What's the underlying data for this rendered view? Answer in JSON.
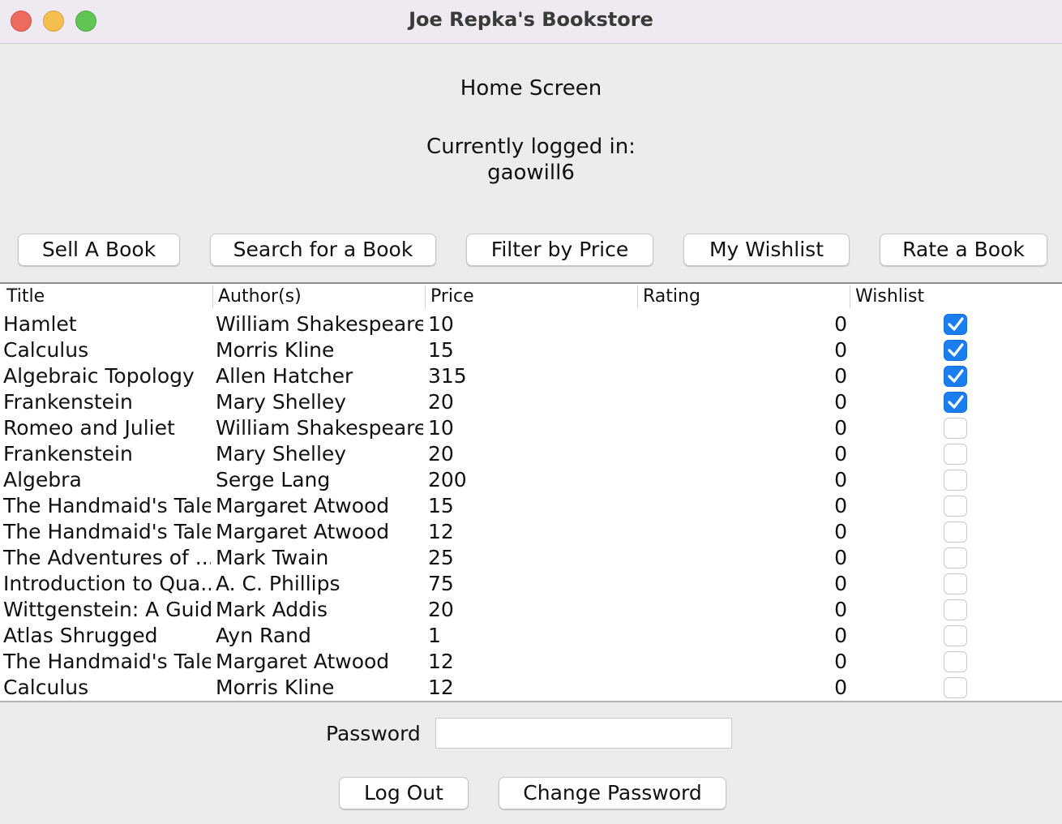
{
  "window": {
    "title": "Joe Repka's Bookstore"
  },
  "header": {
    "screen_title": "Home Screen",
    "logged_in_label": "Currently logged in:",
    "username": "gaowill6"
  },
  "toolbar": {
    "sell_label": "Sell A Book",
    "search_label": "Search for a Book",
    "filter_label": "Filter by Price",
    "wishlist_label": "My Wishlist",
    "rate_label": "Rate a Book"
  },
  "table": {
    "columns": [
      "Title",
      "Author(s)",
      "Price",
      "Rating",
      "Wishlist"
    ],
    "rows": [
      {
        "title": "Hamlet",
        "author": "William Shakespeare",
        "price": "10",
        "rating": "0",
        "wishlist": true
      },
      {
        "title": "Calculus",
        "author": "Morris Kline",
        "price": "15",
        "rating": "0",
        "wishlist": true
      },
      {
        "title": "Algebraic Topology",
        "author": "Allen Hatcher",
        "price": "315",
        "rating": "0",
        "wishlist": true
      },
      {
        "title": "Frankenstein",
        "author": "Mary Shelley",
        "price": "20",
        "rating": "0",
        "wishlist": true
      },
      {
        "title": "Romeo and Juliet",
        "author": "William Shakespeare",
        "price": "10",
        "rating": "0",
        "wishlist": false
      },
      {
        "title": "Frankenstein",
        "author": "Mary Shelley",
        "price": "20",
        "rating": "0",
        "wishlist": false
      },
      {
        "title": "Algebra",
        "author": "Serge Lang",
        "price": "200",
        "rating": "0",
        "wishlist": false
      },
      {
        "title": "The Handmaid's Tale",
        "author": "Margaret Atwood",
        "price": "15",
        "rating": "0",
        "wishlist": false
      },
      {
        "title": "The Handmaid's Tale",
        "author": "Margaret Atwood",
        "price": "12",
        "rating": "0",
        "wishlist": false
      },
      {
        "title": "The Adventures of ...",
        "author": "Mark Twain",
        "price": "25",
        "rating": "0",
        "wishlist": false
      },
      {
        "title": "Introduction to Qua...",
        "author": "A. C. Phillips",
        "price": "75",
        "rating": "0",
        "wishlist": false
      },
      {
        "title": "Wittgenstein: A Guid...",
        "author": "Mark Addis",
        "price": "20",
        "rating": "0",
        "wishlist": false
      },
      {
        "title": "Atlas Shrugged",
        "author": "Ayn Rand",
        "price": "1",
        "rating": "0",
        "wishlist": false
      },
      {
        "title": "The Handmaid's Tale",
        "author": "Margaret Atwood",
        "price": "12",
        "rating": "0",
        "wishlist": false
      },
      {
        "title": "Calculus",
        "author": "Morris Kline",
        "price": "12",
        "rating": "0",
        "wishlist": false
      }
    ]
  },
  "form": {
    "password_label": "Password",
    "password_value": "",
    "logout_label": "Log Out",
    "change_password_label": "Change Password"
  },
  "colors": {
    "checkbox_checked": "#1a7ef1",
    "titlebar": "#efe9f1"
  }
}
